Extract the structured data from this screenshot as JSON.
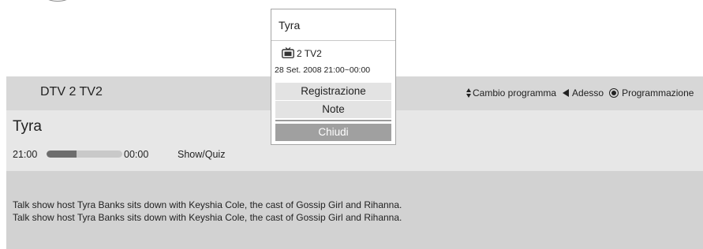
{
  "header": {
    "channel": "DTV 2  TV2",
    "hints": {
      "change_program": "Cambio programma",
      "now": "Adesso",
      "schedule": "Programmazione"
    }
  },
  "program": {
    "title": "Tyra",
    "start_time": "21:00",
    "end_time": "00:00",
    "genre": "Show/Quiz",
    "progress_percent": 40,
    "description": [
      "Talk show host Tyra Banks sits down with Keyshia Cole, the cast of Gossip Girl and Rihanna.",
      "Talk show host Tyra Banks sits down with Keyshia Cole, the cast of Gossip Girl and Rihanna."
    ]
  },
  "popup": {
    "title": "Tyra",
    "channel": "2 TV2",
    "channel_icon": "tv-icon",
    "date_time": "28 Set. 2008 21:00~00:00",
    "buttons": {
      "record": "Registrazione",
      "notes": "Note",
      "close": "Chiudi"
    }
  }
}
